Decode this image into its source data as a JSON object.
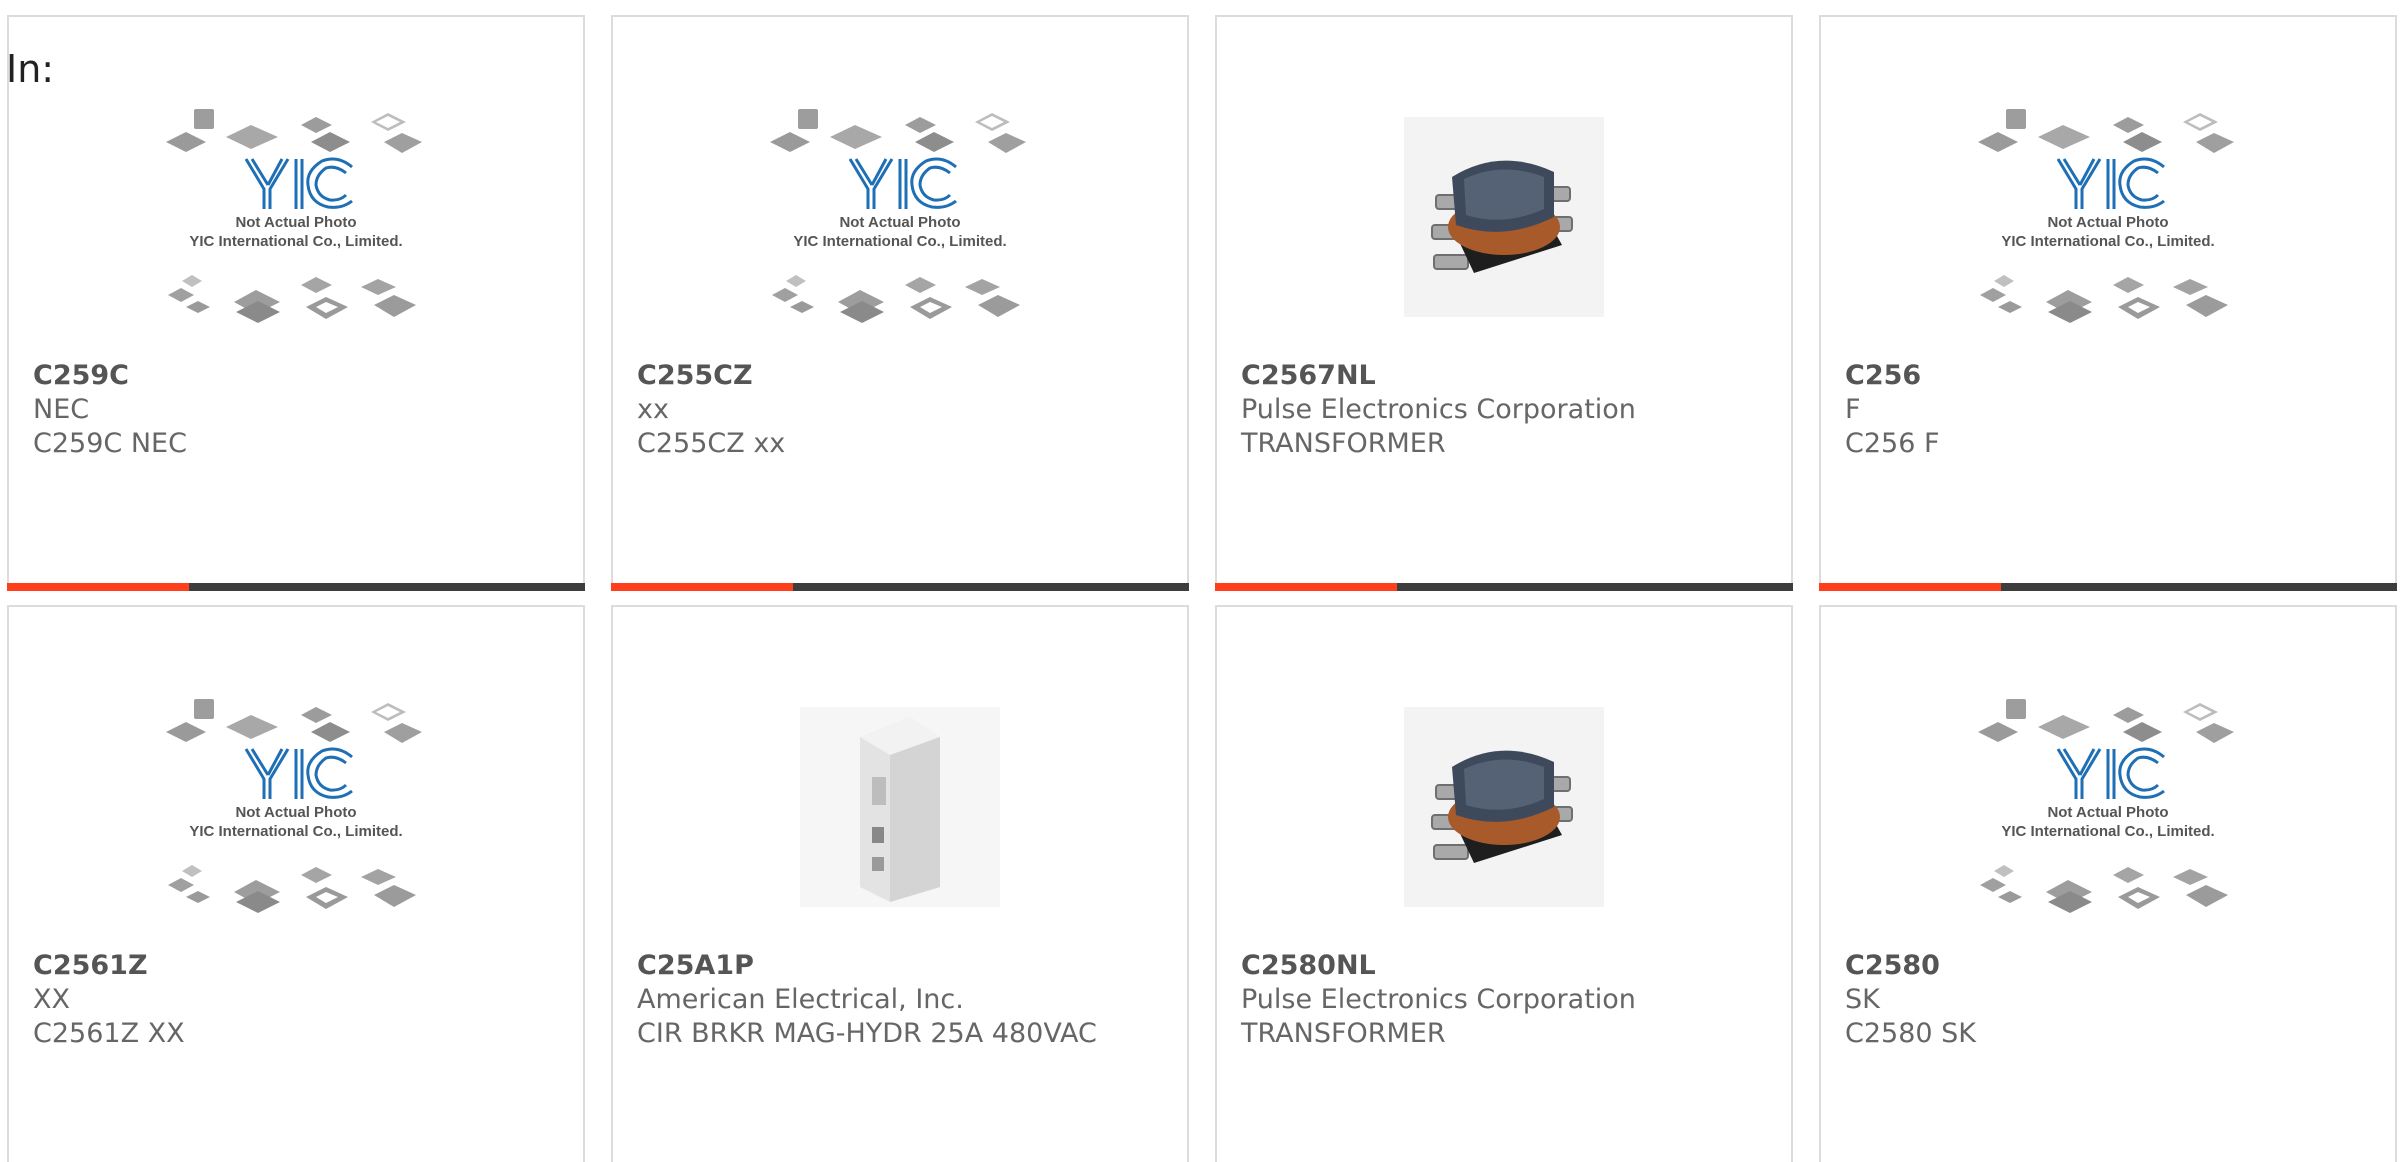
{
  "header": {
    "label": "In:"
  },
  "placeholder_image": {
    "line1": "Not Actual Photo",
    "line2": "YIC International Co., Limited.",
    "logo": "YIC"
  },
  "colors": {
    "accent": "#ff3f1b",
    "bar": "#3d3d3d",
    "logo_blue": "#1f6fb5",
    "border": "#dcdcdc",
    "text": "#666666"
  },
  "products": [
    {
      "part": "C259C",
      "manufacturer": "NEC",
      "description": "C259C NEC",
      "image": "yic-placeholder"
    },
    {
      "part": "C255CZ",
      "manufacturer": "xx",
      "description": "C255CZ xx",
      "image": "yic-placeholder"
    },
    {
      "part": "C2567NL",
      "manufacturer": "Pulse Electronics Corporation",
      "description": "TRANSFORMER",
      "image": "transformer-photo"
    },
    {
      "part": "C256",
      "manufacturer": "F",
      "description": "C256 F",
      "image": "yic-placeholder"
    },
    {
      "part": "C2561Z",
      "manufacturer": "XX",
      "description": "C2561Z XX",
      "image": "yic-placeholder"
    },
    {
      "part": "C25A1P",
      "manufacturer": "American Electrical, Inc.",
      "description": "CIR BRKR MAG-HYDR 25A 480VAC",
      "image": "circuit-breaker-photo"
    },
    {
      "part": "C2580NL",
      "manufacturer": "Pulse Electronics Corporation",
      "description": "TRANSFORMER",
      "image": "transformer-photo"
    },
    {
      "part": "C2580",
      "manufacturer": "SK",
      "description": "C2580 SK",
      "image": "yic-placeholder"
    }
  ]
}
